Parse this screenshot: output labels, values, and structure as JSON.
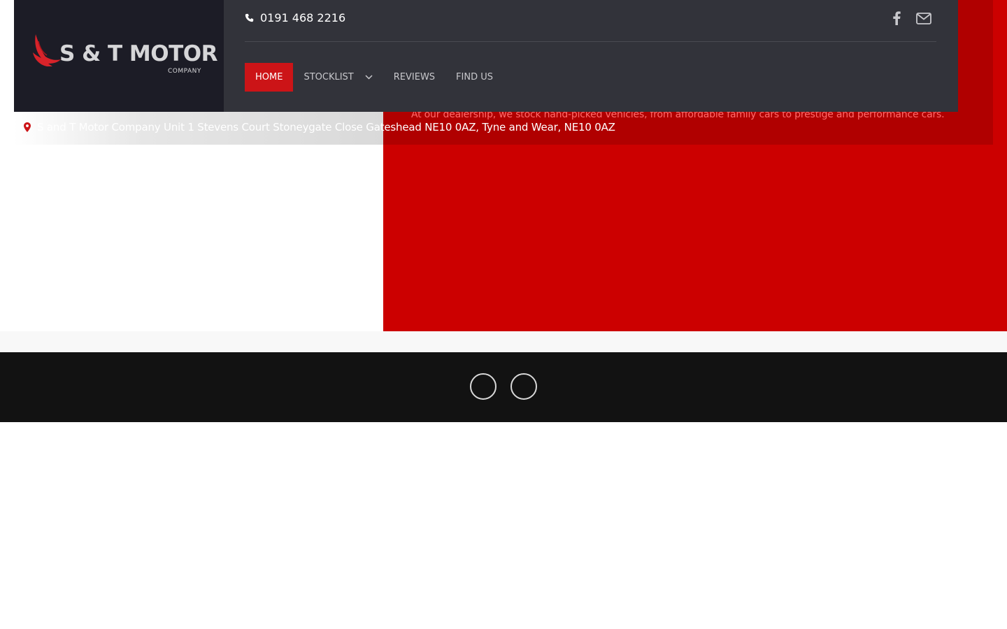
{
  "header": {
    "phone": "0191 468 2216",
    "icons": {
      "phone": "phone-icon",
      "facebook": "facebook-icon",
      "email": "envelope-icon"
    }
  },
  "logo": {
    "text": "S & T MOTOR",
    "sub": "COMPANY",
    "icon": "eagle-icon"
  },
  "nav": {
    "items": [
      {
        "label": "HOME",
        "active": true
      },
      {
        "label": "STOCKLIST",
        "dropdown": true
      },
      {
        "label": "REVIEWS"
      },
      {
        "label": "FIND US"
      }
    ]
  },
  "address": {
    "icon": "map-pin-icon",
    "text": "S and T Motor Company Unit 1 Stevens Court Stoneygate Close Gateshead NE10 0AZ, Tyne and Wear, NE10 0AZ"
  },
  "hero": {
    "tagline": "At our dealership, we stock hand-picked vehicles, from affordable family cars to prestige and performance cars."
  },
  "footer": {
    "social_buttons": [
      "social-circle-1",
      "social-circle-2"
    ]
  },
  "colors": {
    "brand_red": "#cc1417",
    "hero_red": "#cc0000",
    "header_dark": "#32333a",
    "logo_bg": "#1c1c26",
    "footer_bg": "#121212"
  }
}
